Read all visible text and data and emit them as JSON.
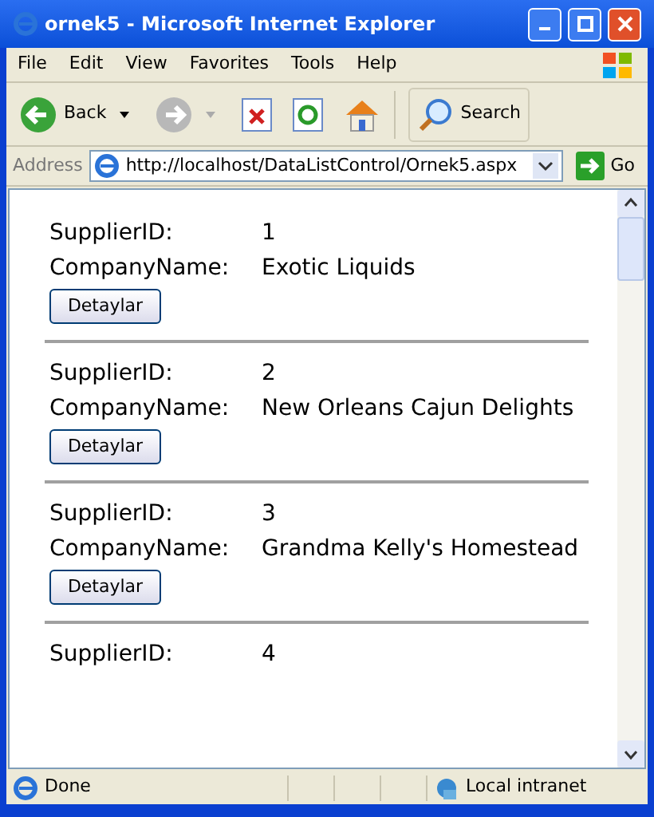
{
  "window": {
    "title": "ornek5 - Microsoft Internet Explorer"
  },
  "menu": [
    "File",
    "Edit",
    "View",
    "Favorites",
    "Tools",
    "Help"
  ],
  "toolbar": {
    "back": "Back",
    "search": "Search"
  },
  "address": {
    "label": "Address",
    "url": "http://localhost/DataListControl/Ornek5.aspx",
    "go": "Go"
  },
  "items": [
    {
      "id_label": "SupplierID:",
      "id": "1",
      "name_label": "CompanyName:",
      "name": "Exotic Liquids",
      "button": "Detaylar"
    },
    {
      "id_label": "SupplierID:",
      "id": "2",
      "name_label": "CompanyName:",
      "name": "New Orleans Cajun Delights",
      "button": "Detaylar"
    },
    {
      "id_label": "SupplierID:",
      "id": "3",
      "name_label": "CompanyName:",
      "name": "Grandma Kelly's Homestead",
      "button": "Detaylar"
    },
    {
      "id_label": "SupplierID:",
      "id": "4"
    }
  ],
  "status_bar": {
    "text": "Done",
    "zone": "Local intranet"
  }
}
